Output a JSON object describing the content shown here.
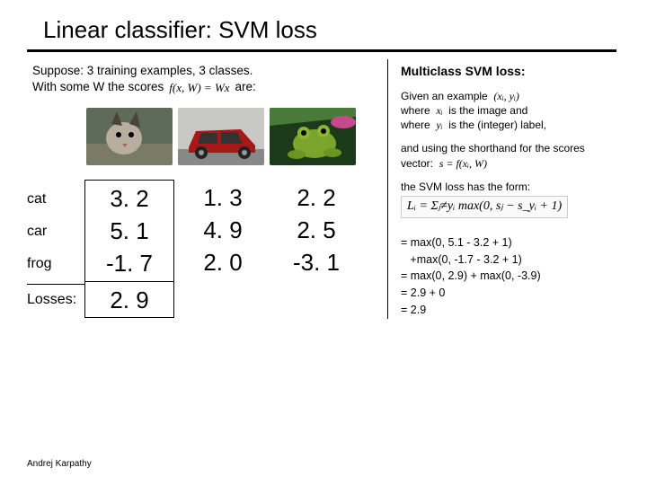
{
  "title": "Linear classifier: SVM loss",
  "suppose": {
    "line1": "Suppose: 3 training examples, 3 classes.",
    "line2a": "With some W the scores",
    "fx": "f(x, W) = Wx",
    "line2b": "are:"
  },
  "thumbs": {
    "a": "cat-image",
    "b": "car-image",
    "c": "frog-image"
  },
  "labels": {
    "cat": "cat",
    "car": "car",
    "frog": "frog",
    "losses": "Losses:"
  },
  "scores": {
    "col1": {
      "cat": "3. 2",
      "car": "5. 1",
      "frog": "-1. 7",
      "loss": "2. 9"
    },
    "col2": {
      "cat": "1. 3",
      "car": "4. 9",
      "frog": "2. 0"
    },
    "col3": {
      "cat": "2. 2",
      "car": "2. 5",
      "frog": "-3. 1"
    }
  },
  "right": {
    "hdr": "Multiclass SVM loss:",
    "given1": "Given an example",
    "pair": "(xᵢ, yᵢ)",
    "given2a": "where",
    "given2b": "is the image and",
    "given3b": "is the (integer) label,",
    "xi": "xᵢ",
    "yi": "yᵢ",
    "shorthand": "and using the shorthand for the scores vector:",
    "svec": "s = f(xᵢ, W)",
    "hasform": "the SVM loss has the form:",
    "formula": "Lᵢ = Σⱼ≠yᵢ max(0, sⱼ − s_yᵢ + 1)",
    "calc": "= max(0, 5.1 - 3.2 + 1)\n   +max(0, -1.7 - 3.2 + 1)\n= max(0, 2.9) + max(0, -3.9)\n= 2.9 + 0\n= 2.9"
  },
  "credit": "Andrej Karpathy"
}
